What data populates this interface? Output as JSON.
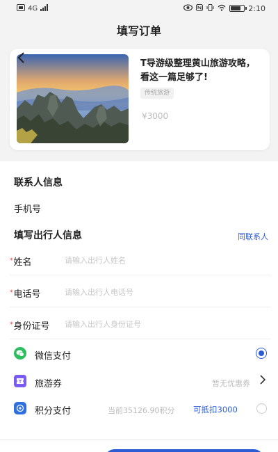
{
  "status_bar": {
    "left_icons": [
      "sim-icon",
      "signal-icon"
    ],
    "right_icons": [
      "eye-icon",
      "nfc-icon",
      "vibrate-icon",
      "wifi-icon",
      "battery-icon"
    ],
    "network_text": "4G",
    "battery_level": 0.8,
    "time": "2:10"
  },
  "header": {
    "title": "填写订单"
  },
  "product": {
    "title": "T导游级整理黄山旅游攻略，看这一篇足够了!",
    "tag": "传统旅游",
    "price": "¥3000"
  },
  "contact": {
    "section_title": "联系人信息",
    "phone_label": "手机号"
  },
  "traveler": {
    "section_title": "填写出行人信息",
    "same_contact_label": "同联系人",
    "required_mark": "*",
    "name_label": "姓名",
    "name_placeholder": "请输入出行人姓名",
    "name_value": "",
    "phone_label": "电话号",
    "phone_placeholder": "请输入出行人电话号",
    "phone_value": "",
    "id_label": "身份证号",
    "id_placeholder": "请输入出行人身份证号",
    "id_value": ""
  },
  "payment": {
    "wechat_label": "微信支付",
    "wechat_selected": true,
    "coupon_label": "旅游券",
    "coupon_value": "暂无优惠券",
    "points_label": "积分支付",
    "points_balance": "当前35126.90积分",
    "points_deduct": "可抵扣3000",
    "points_selected": false
  },
  "colors": {
    "accent": "#2c5bd6",
    "wechat_green": "#2dbe60",
    "coupon_purple": "#7a5cf0",
    "points_blue": "#2f6fe0",
    "required_red": "#e23c3c"
  }
}
